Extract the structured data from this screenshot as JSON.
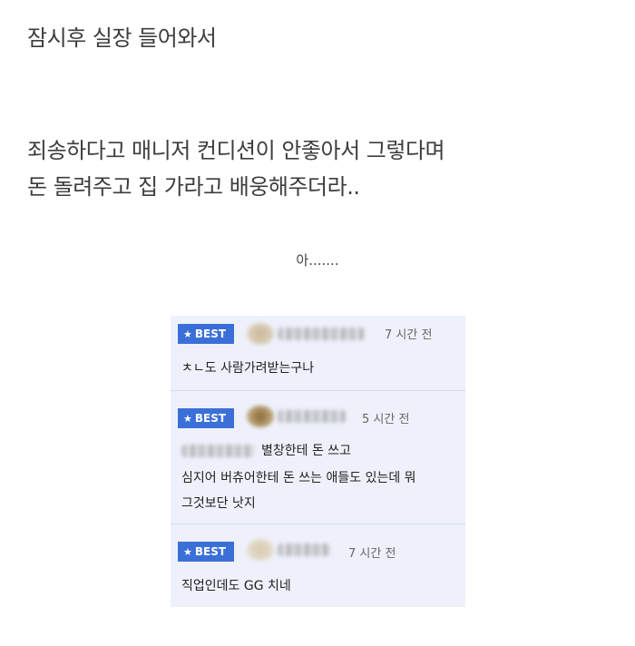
{
  "post": {
    "line1": "잠시후 실장 들어와서",
    "line2": "죄송하다고 매니저 컨디션이 안좋아서 그렇다며",
    "line3": "돈 돌려주고 집 가라고 배웅해주더라..",
    "line4": "아......."
  },
  "comments": [
    {
      "badge": "BEST",
      "time": "7 시간 전",
      "text_lines": [
        "ㅊㄴ도 사람가려받는구나"
      ]
    },
    {
      "badge": "BEST",
      "time": "5 시간 전",
      "text_lines": [
        "별창한테 돈 쓰고",
        "심지어 버츄어한테 돈 쓰는 애들도 있는데 뭐",
        "그것보단 낫지"
      ]
    },
    {
      "badge": "BEST",
      "time": "7 시간 전",
      "text_lines": [
        "직업인데도 GG 치네"
      ]
    }
  ],
  "icons": {
    "badge_icon": "star-icon",
    "avatar": "blurred-avatar"
  },
  "colors": {
    "badge_bg": "#3b6fd8",
    "panel_bg": "#eef1fb",
    "divider": "#d7dbe7"
  }
}
